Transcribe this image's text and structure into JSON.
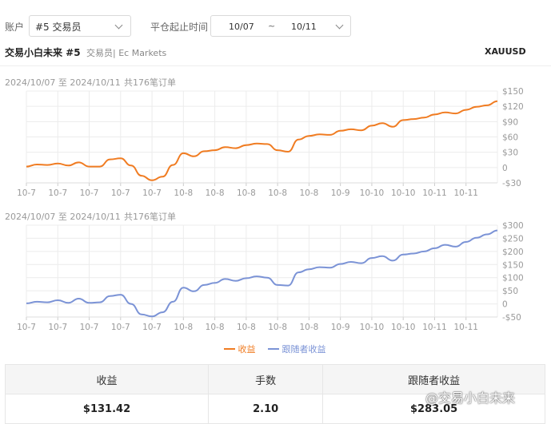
{
  "filters": {
    "account_label": "账户",
    "account_value": "#5 交易员",
    "date_label": "平仓起止时间",
    "date_from": "10/07",
    "date_sep": "~",
    "date_to": "10/11"
  },
  "header": {
    "trader_name": "交易小白未来 #5",
    "trader_sub": "交易员| Ec Markets",
    "symbol": "XAUUSD"
  },
  "chart1_range": "2024/10/07 至 2024/10/11",
  "chart1_orders": "共176笔订单",
  "chart2_range": "2024/10/07 至 2024/10/11",
  "chart2_orders": "共176笔订单",
  "legend": {
    "series1": "收益",
    "series2": "跟随者收益"
  },
  "summary": {
    "headers": [
      "收益",
      "手数",
      "跟随者收益"
    ],
    "values": [
      "$131.42",
      "2.10",
      "$283.05"
    ]
  },
  "watermark": "@交易小白未来",
  "colors": {
    "series1": "#f07c22",
    "series2": "#7b93d6"
  },
  "chart_data": [
    {
      "type": "line",
      "x": [
        "10-7",
        "10-7",
        "10-7",
        "10-7",
        "10-7",
        "10-8",
        "10-8",
        "10-8",
        "10-8",
        "10-8",
        "10-9",
        "10-10",
        "10-10",
        "10-11",
        "10-11"
      ],
      "series": [
        {
          "name": "收益",
          "values": [
            2,
            6,
            5,
            8,
            4,
            10,
            2,
            2,
            16,
            18,
            4,
            -16,
            -25,
            -18,
            5,
            28,
            22,
            32,
            34,
            40,
            38,
            44,
            47,
            46,
            34,
            31,
            55,
            62,
            65,
            64,
            72,
            75,
            73,
            82,
            87,
            80,
            93,
            95,
            98,
            104,
            108,
            106,
            113,
            119,
            122,
            130
          ]
        }
      ],
      "yticks": [
        "$150",
        "$120",
        "$90",
        "$60",
        "$30",
        "0",
        "-$30"
      ],
      "ylim": [
        -30,
        150
      ]
    },
    {
      "type": "line",
      "x": [
        "10-7",
        "10-7",
        "10-7",
        "10-7",
        "10-7",
        "10-8",
        "10-8",
        "10-8",
        "10-8",
        "10-8",
        "10-9",
        "10-10",
        "10-10",
        "10-11",
        "10-11"
      ],
      "series": [
        {
          "name": "跟随者收益",
          "values": [
            2,
            8,
            6,
            14,
            4,
            20,
            4,
            6,
            30,
            35,
            0,
            -40,
            -48,
            -32,
            8,
            62,
            48,
            72,
            80,
            95,
            88,
            98,
            105,
            100,
            72,
            70,
            120,
            132,
            140,
            138,
            152,
            160,
            155,
            175,
            182,
            165,
            188,
            192,
            200,
            212,
            225,
            218,
            236,
            252,
            265,
            280
          ]
        }
      ],
      "yticks": [
        "$300",
        "$250",
        "$200",
        "$150",
        "$100",
        "$50",
        "0",
        "-$50"
      ],
      "ylim": [
        -50,
        300
      ]
    }
  ]
}
